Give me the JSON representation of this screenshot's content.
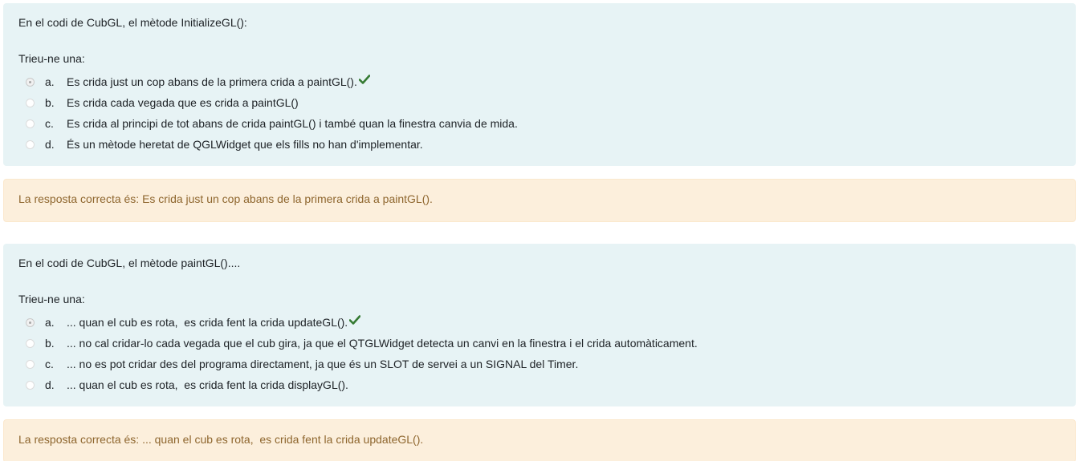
{
  "questions": [
    {
      "text": "En el codi de CubGL, el mètode InitializeGL():",
      "prompt": "Trieu-ne una:",
      "answers": [
        {
          "letter": "a.",
          "text": "Es crida just un cop abans de la primera crida a paintGL().",
          "selected": true,
          "correct_mark": true
        },
        {
          "letter": "b.",
          "text": "Es crida cada vegada que es crida a paintGL()",
          "selected": false
        },
        {
          "letter": "c.",
          "text": "Es crida al principi de tot abans de crida paintGL() i també quan la finestra canvia de mida.",
          "selected": false
        },
        {
          "letter": "d.",
          "text": "És un mètode heretat de QGLWidget que els fills no han d'implementar.",
          "selected": false
        }
      ],
      "feedback": "La resposta correcta és: Es crida just un cop abans de la primera crida a paintGL()."
    },
    {
      "text": "En el codi de CubGL, el mètode paintGL()....",
      "prompt": "Trieu-ne una:",
      "answers": [
        {
          "letter": "a.",
          "text": "... quan el cub es rota,  es crida fent la crida updateGL().",
          "selected": true,
          "correct_mark": true
        },
        {
          "letter": "b.",
          "text": "... no cal cridar-lo cada vegada que el cub gira, ja que el QTGLWidget detecta un canvi en la finestra i el crida automàticament.",
          "selected": false
        },
        {
          "letter": "c.",
          "text": "... no es pot cridar des del programa directament, ja que és un SLOT de servei a un SIGNAL del Timer.",
          "selected": false
        },
        {
          "letter": "d.",
          "text": "... quan el cub es rota,  es crida fent la crida displayGL().",
          "selected": false
        }
      ],
      "feedback": "La resposta correcta és: ... quan el cub es rota,  es crida fent la crida updateGL()."
    }
  ],
  "colors": {
    "question_bg": "#e7f3f5",
    "feedback_bg": "#fcefdc",
    "feedback_text": "#8e662e",
    "check": "#357a32"
  },
  "icons": {
    "correct": "check-icon"
  }
}
